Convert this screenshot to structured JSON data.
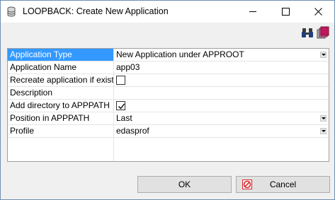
{
  "window": {
    "title": "LOOPBACK: Create New Application",
    "controls": {
      "minimize": "—",
      "maximize": "☐",
      "close": "✕"
    }
  },
  "toolbar": {
    "icons": [
      "binoculars-icon",
      "layers-icon"
    ]
  },
  "properties": [
    {
      "label": "Application Type",
      "value": "New Application under APPROOT",
      "kind": "dropdown",
      "selected": true
    },
    {
      "label": "Application Name",
      "value": "app03",
      "kind": "text"
    },
    {
      "label": "Recreate application if exists",
      "value": "",
      "kind": "checkbox",
      "checked": false
    },
    {
      "label": "Description",
      "value": "",
      "kind": "text"
    },
    {
      "label": "Add directory to APPPATH",
      "value": "",
      "kind": "checkbox",
      "checked": true
    },
    {
      "label": "Position in APPPATH",
      "value": "Last",
      "kind": "dropdown"
    },
    {
      "label": "Profile",
      "value": "edasprof",
      "kind": "dropdown"
    }
  ],
  "buttons": {
    "ok": "OK",
    "cancel": "Cancel"
  },
  "colors": {
    "selection": "#3399ff",
    "cancel_icon": "#d9262a",
    "layers_icon": "#c2185b"
  }
}
